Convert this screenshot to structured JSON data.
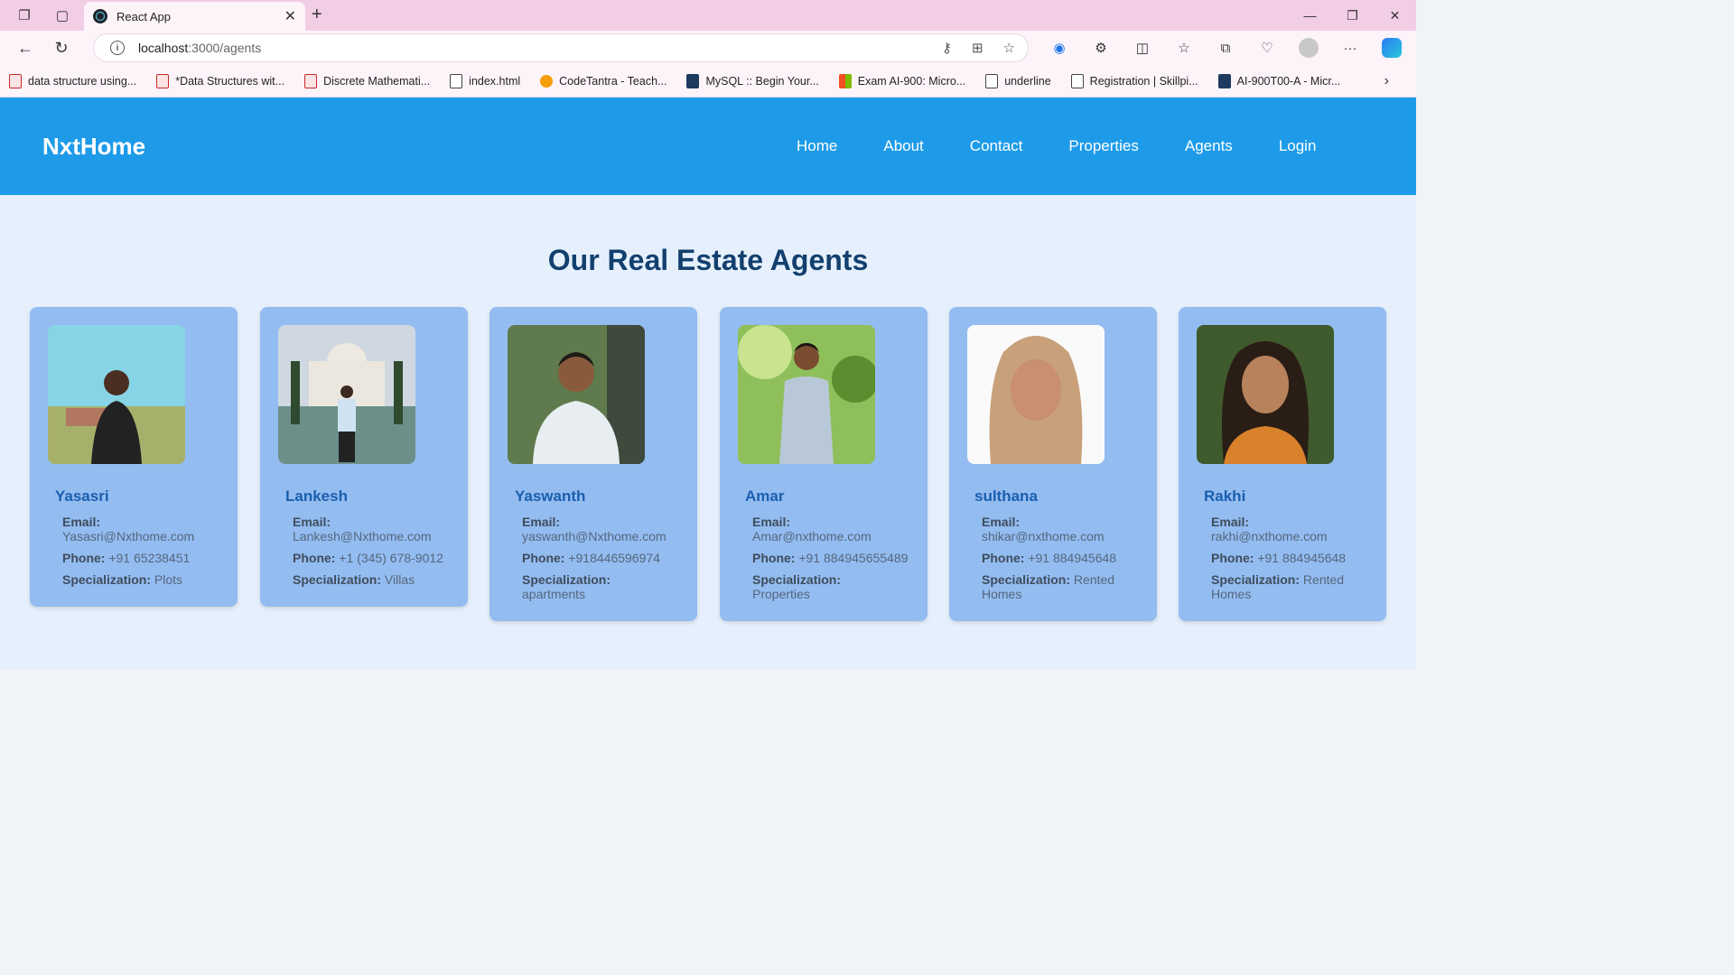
{
  "browser": {
    "tab_title": "React App",
    "url_host": "localhost",
    "url_rest": ":3000/agents",
    "bookmarks": [
      {
        "label": "data structure using..."
      },
      {
        "label": "*Data Structures wit..."
      },
      {
        "label": "Discrete Mathemati..."
      },
      {
        "label": "index.html"
      },
      {
        "label": "CodeTantra - Teach..."
      },
      {
        "label": "MySQL :: Begin Your..."
      },
      {
        "label": "Exam AI-900: Micro..."
      },
      {
        "label": "underline"
      },
      {
        "label": "Registration | Skillpi..."
      },
      {
        "label": "AI-900T00-A - Micr..."
      }
    ]
  },
  "header": {
    "brand": "NxtHome",
    "nav": [
      "Home",
      "About",
      "Contact",
      "Properties",
      "Agents",
      "Login"
    ]
  },
  "main": {
    "title": "Our Real Estate Agents",
    "labels": {
      "email": "Email:",
      "phone": "Phone:",
      "specialization": "Specialization:"
    },
    "agents": [
      {
        "name": "Yasasri",
        "email": "Yasasri@Nxthome.com",
        "phone": "+91 65238451",
        "specialization": "Plots"
      },
      {
        "name": "Lankesh",
        "email": "Lankesh@Nxthome.com",
        "phone": "+1 (345) 678-9012",
        "specialization": "Villas"
      },
      {
        "name": "Yaswanth",
        "email": "yaswanth@Nxthome.com",
        "phone": "+918446596974",
        "specialization": "apartments"
      },
      {
        "name": "Amar",
        "email": "Amar@nxthome.com",
        "phone": "+91 884945655489",
        "specialization": "Properties"
      },
      {
        "name": "sulthana",
        "email": "shikar@nxthome.com",
        "phone": "+91 884945648",
        "specialization": "Rented Homes"
      },
      {
        "name": "Rakhi",
        "email": "rakhi@nxthome.com",
        "phone": "+91 884945648",
        "specialization": "Rented Homes"
      }
    ]
  }
}
